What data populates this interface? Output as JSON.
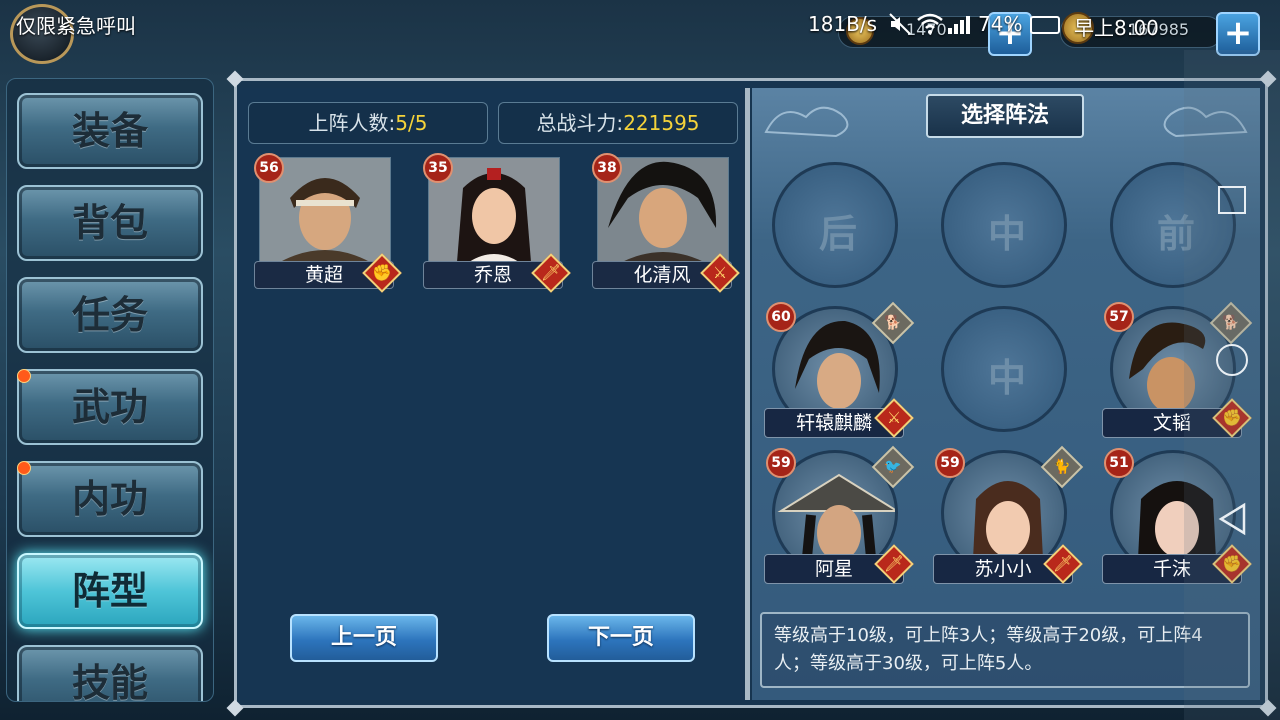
{
  "status": {
    "left_text": "仅限紧急呼叫",
    "speed": "181B/s",
    "resource1": "1470",
    "battery": "74%",
    "time": "早上8:00",
    "resource2": "167985"
  },
  "menu": {
    "items": [
      {
        "label": "装备",
        "dot": false,
        "active": false
      },
      {
        "label": "背包",
        "dot": false,
        "active": false
      },
      {
        "label": "任务",
        "dot": false,
        "active": false
      },
      {
        "label": "武功",
        "dot": true,
        "active": false
      },
      {
        "label": "内功",
        "dot": true,
        "active": false
      },
      {
        "label": "阵型",
        "dot": false,
        "active": true
      },
      {
        "label": "技能",
        "dot": false,
        "active": false
      }
    ]
  },
  "roster": {
    "count_label": "上阵人数:",
    "count_value": "5/5",
    "power_label": "总战斗力:",
    "power_value": "221595",
    "heroes": [
      {
        "name": "黄超",
        "level": "56",
        "type_icon": "fist-icon"
      },
      {
        "name": "乔恩",
        "level": "35",
        "type_icon": "sword-icon"
      },
      {
        "name": "化清风",
        "level": "38",
        "type_icon": "crossed-swords-icon"
      }
    ],
    "prev_label": "上一页",
    "next_label": "下一页"
  },
  "formation": {
    "title": "选择阵法",
    "empty_slots": [
      "后",
      "中",
      "前",
      "中"
    ],
    "heroes": [
      {
        "name": "轩辕麒麟",
        "level": "60",
        "type_icon": "crossed-swords-icon",
        "pet_icon": "dog-icon"
      },
      {
        "name": "文韬",
        "level": "57",
        "type_icon": "fist-icon",
        "pet_icon": "dog-icon"
      },
      {
        "name": "阿星",
        "level": "59",
        "type_icon": "sword-icon",
        "pet_icon": "bird-icon"
      },
      {
        "name": "苏小小",
        "level": "59",
        "type_icon": "sword-icon",
        "pet_icon": "cat-icon"
      },
      {
        "name": "千沫",
        "level": "51",
        "type_icon": "fist-icon",
        "pet_icon": null
      }
    ],
    "rule_text": "等级高于10级，可上阵3人；等级高于20级，可上阵4人；等级高于30级，可上阵5人。"
  }
}
